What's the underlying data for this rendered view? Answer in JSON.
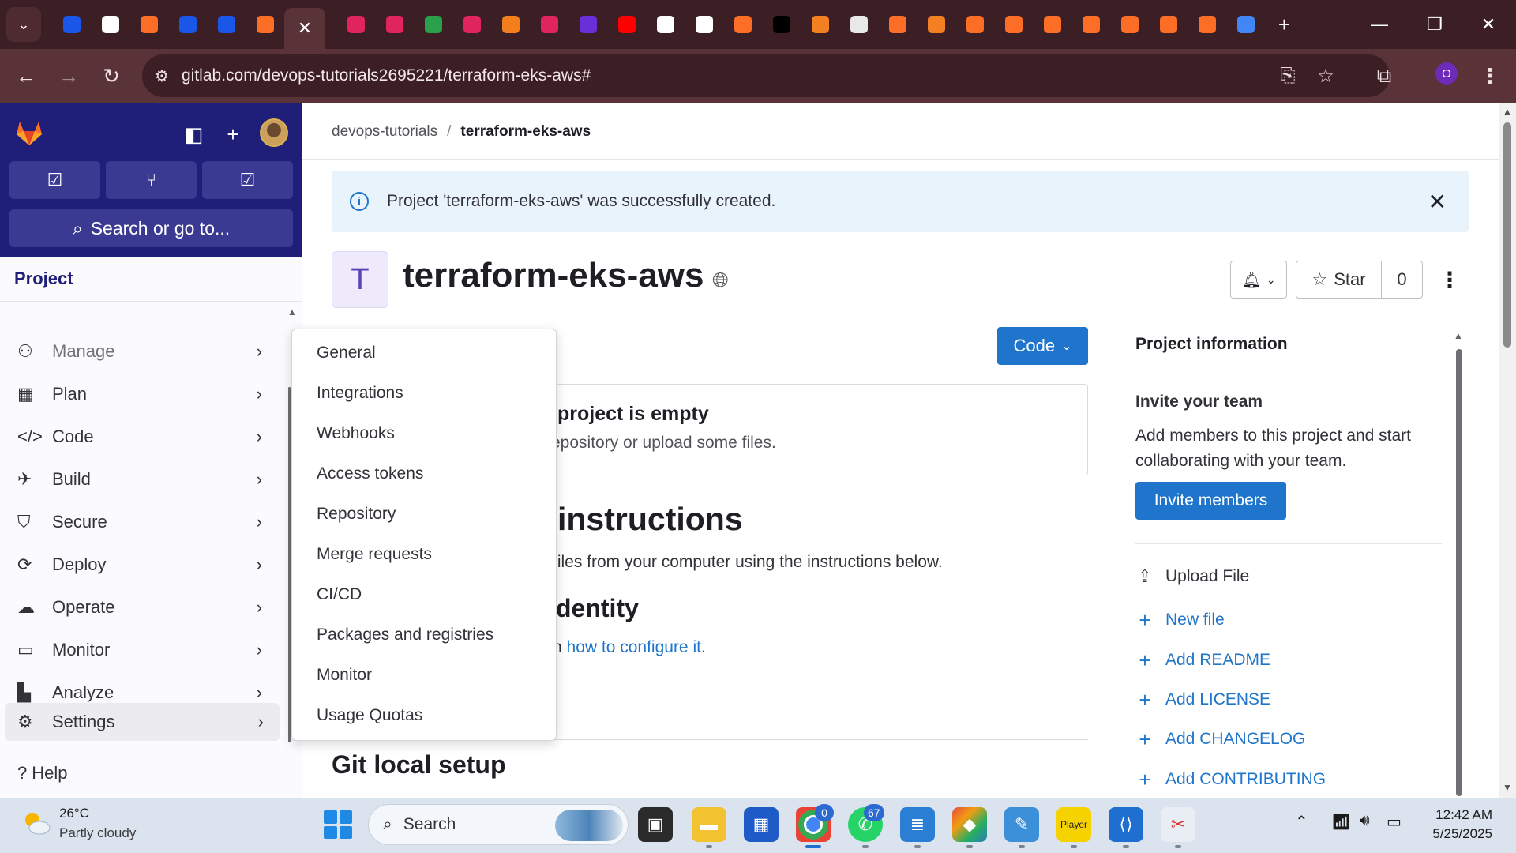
{
  "browser": {
    "url": "gitlab.com/devops-tutorials2695221/terraform-eks-aws#",
    "profile_initial": "O",
    "tab_close": "✕",
    "new_tab": "+",
    "tab_icon_colors": [
      "#1a56e8",
      "#ffffff",
      "#fc6d26",
      "#1a56e8",
      "#1a56e8",
      "#fc6d26",
      "#e0245e",
      "#e0245e",
      "#2aa04a",
      "#e0245e",
      "#f27f1b",
      "#e0245e",
      "#6b2fd9",
      "#ff0000",
      "#ffffff",
      "#ffffff",
      "#fc6d26",
      "#000000",
      "#f48024",
      "#e8e8e8",
      "#fc6d26",
      "#f48024",
      "#fc6d26",
      "#fc6d26",
      "#fc6d26",
      "#fc6d26",
      "#fc6d26",
      "#fc6d26",
      "#fc6d26",
      "#4285f4"
    ]
  },
  "sidebar": {
    "search_label": "Search or go to...",
    "section_title": "Project",
    "items": [
      {
        "label": "Manage",
        "icon": "users-icon"
      },
      {
        "label": "Plan",
        "icon": "calendar-icon"
      },
      {
        "label": "Code",
        "icon": "code-icon"
      },
      {
        "label": "Build",
        "icon": "rocket-icon"
      },
      {
        "label": "Secure",
        "icon": "shield-icon"
      },
      {
        "label": "Deploy",
        "icon": "deploy-icon"
      },
      {
        "label": "Operate",
        "icon": "cloud-gear-icon"
      },
      {
        "label": "Monitor",
        "icon": "monitor-icon"
      },
      {
        "label": "Analyze",
        "icon": "chart-icon"
      },
      {
        "label": "Settings",
        "icon": "gear-icon"
      }
    ],
    "help_label": "Help"
  },
  "breadcrumb": {
    "group": "devops-tutorials",
    "separator": "/",
    "project": "terraform-eks-aws"
  },
  "alert": {
    "message": "Project 'terraform-eks-aws' was successfully created."
  },
  "project": {
    "avatar_letter": "T",
    "name": "terraform-eks-aws",
    "star_label": "Star",
    "star_count": "0",
    "code_button": "Code"
  },
  "main": {
    "empty_title": "project is empty",
    "empty_text": "epository or upload some files.",
    "instructions_heading": "instructions",
    "instructions_text": "files from your computer using the instructions below.",
    "identity_heading": "dentity",
    "identity_text_prefix": "n ",
    "identity_link": "how to configure it",
    "identity_text_suffix": ".",
    "git_heading": "Git local setup"
  },
  "settings_menu": {
    "items": [
      "General",
      "Integrations",
      "Webhooks",
      "Access tokens",
      "Repository",
      "Merge requests",
      "CI/CD",
      "Packages and registries",
      "Monitor",
      "Usage Quotas"
    ]
  },
  "right_panel": {
    "title": "Project information",
    "invite_title": "Invite your team",
    "invite_text": "Add members to this project and start collaborating with your team.",
    "invite_button": "Invite members",
    "links": [
      {
        "label": "Upload File",
        "icon": "upload-icon"
      },
      {
        "label": "New file",
        "icon": "plus-icon"
      },
      {
        "label": "Add README",
        "icon": "plus-icon"
      },
      {
        "label": "Add LICENSE",
        "icon": "plus-icon"
      },
      {
        "label": "Add CHANGELOG",
        "icon": "plus-icon"
      },
      {
        "label": "Add CONTRIBUTING",
        "icon": "plus-icon"
      }
    ]
  },
  "taskbar": {
    "weather_temp": "26°C",
    "weather_desc": "Partly cloudy",
    "search_label": "Search",
    "chrome_badge": "0",
    "whatsapp_badge": "67",
    "time": "12:42 AM",
    "date": "5/25/2025"
  },
  "colors": {
    "brand_blue": "#1f75cb",
    "sidebar_dark": "#1f1f7a",
    "gitlab_orange": "#fc6d26"
  }
}
